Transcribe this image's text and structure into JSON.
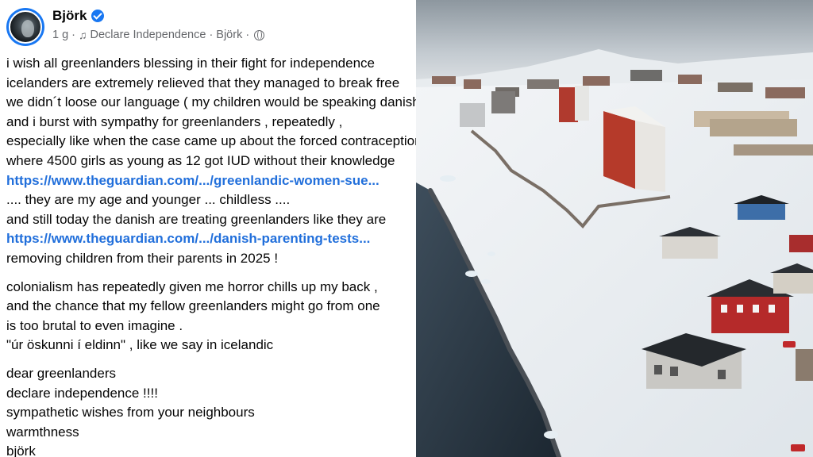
{
  "post": {
    "author": "Björk",
    "time": "1 g",
    "dot1": "·",
    "music_icon": "music-note-icon",
    "song": "Declare Independence",
    "dot2": "·",
    "artist": "Björk",
    "dot3": "·",
    "privacy_icon": "globe-icon",
    "lines": [
      "i wish all greenlanders blessing in their fight for independence",
      "icelanders are extremely relieved that they managed to break free",
      "we didn´t loose our language ( my children would be speaking danish",
      "and i burst with sympathy for greenlanders , repeatedly ,",
      "especially like when the case came up about the forced contraception",
      "where 4500 girls as young as 12 got IUD without their knowledge",
      "https://www.theguardian.com/.../greenlandic-women-sue...",
      ".... they are my age and younger ... childless ....",
      "and still today the danish are treating greenlanders like they are",
      "https://www.theguardian.com/.../danish-parenting-tests...",
      "removing children from their parents in 2025 !",
      "colonialism has repeatedly given me horror chills up my back ,",
      "and the chance that my fellow greenlanders might go from one",
      "is too brutal to even imagine .",
      "\"úr öskunni í eldinn\" , like we say in icelandic",
      "dear greenlanders",
      "declare independence !!!!",
      "sympathetic wishes from your neighbours",
      "warmthness",
      "björk"
    ]
  },
  "colors": {
    "link": "#216fdb",
    "verified": "#1877f2",
    "meta": "#65676b"
  }
}
